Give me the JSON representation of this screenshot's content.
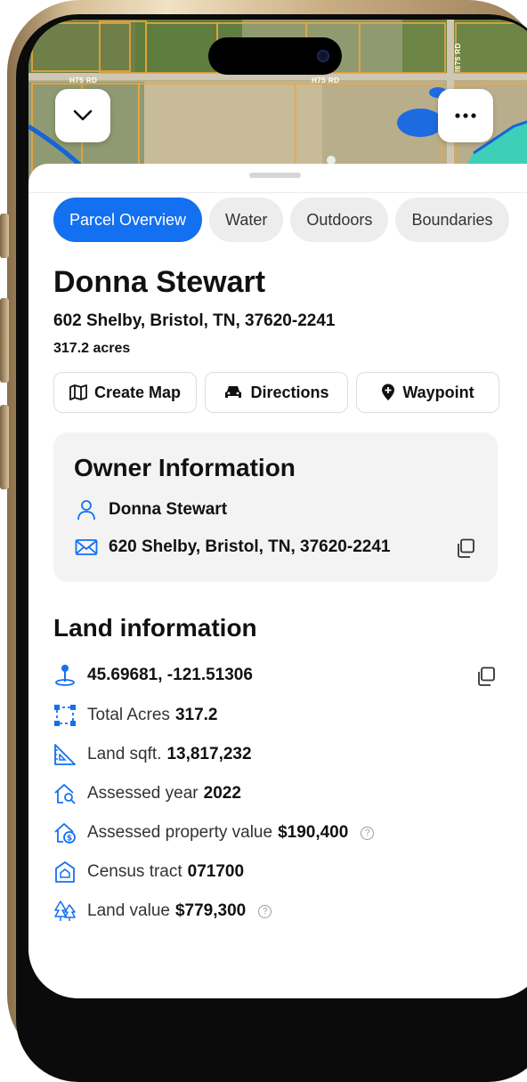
{
  "map": {
    "road_labels": [
      "H75 RD",
      "H75 RD",
      "I675 RD"
    ]
  },
  "tabs": [
    {
      "label": "Parcel Overview",
      "active": true
    },
    {
      "label": "Water",
      "active": false
    },
    {
      "label": "Outdoors",
      "active": false
    },
    {
      "label": "Boundaries",
      "active": false
    }
  ],
  "parcel": {
    "owner_name": "Donna Stewart",
    "address": "602 Shelby, Bristol, TN, 37620-2241",
    "acres": "317.2 acres"
  },
  "actions": {
    "create_map": "Create Map",
    "directions": "Directions",
    "waypoint": "Waypoint"
  },
  "owner_info": {
    "title": "Owner Information",
    "name": "Donna Stewart",
    "mailing_address": "620 Shelby, Bristol, TN, 37620-2241"
  },
  "land_info": {
    "title": "Land information",
    "coordinates": "45.69681, -121.51306",
    "rows": [
      {
        "label": "Total Acres",
        "value": "317.2",
        "icon": "bounding-box-icon"
      },
      {
        "label": "Land sqft.",
        "value": "13,817,232",
        "icon": "ruler-triangle-icon"
      },
      {
        "label": "Assessed year",
        "value": "2022",
        "icon": "house-search-icon"
      },
      {
        "label": "Assessed property value",
        "value": "$190,400",
        "icon": "house-dollar-icon"
      },
      {
        "label": "Census tract",
        "value": "071700",
        "icon": "census-house-icon"
      },
      {
        "label": "Land value",
        "value": "$779,300",
        "icon": "trees-icon"
      }
    ]
  },
  "colors": {
    "accent": "#1370f0",
    "map_water": "#3ecfb8",
    "parcel_outline": "#f0a63a"
  }
}
